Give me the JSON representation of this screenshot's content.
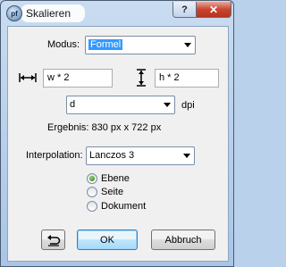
{
  "window": {
    "title": "Skalieren",
    "help_button": "?",
    "close_button": "✕"
  },
  "modus": {
    "label": "Modus:",
    "value": "Formel"
  },
  "width": {
    "icon": "horizontal-resize-icon",
    "value": "w * 2"
  },
  "height": {
    "icon": "vertical-resize-icon",
    "value": "h * 2"
  },
  "unit": {
    "value": "d",
    "suffix": "dpi"
  },
  "result": {
    "text": "Ergebnis: 830 px x 722 px"
  },
  "interpolation": {
    "label": "Interpolation:",
    "value": "Lanczos 3"
  },
  "scope": {
    "options": [
      {
        "label": "Ebene",
        "checked": true
      },
      {
        "label": "Seite",
        "checked": false
      },
      {
        "label": "Dokument",
        "checked": false
      }
    ]
  },
  "buttons": {
    "reset_icon": "undo-icon",
    "ok": "OK",
    "cancel": "Abbruch"
  }
}
